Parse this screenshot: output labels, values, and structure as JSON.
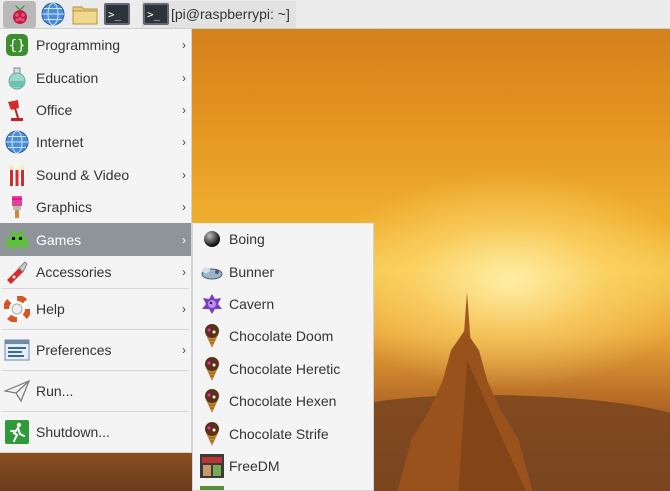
{
  "taskbar": {
    "launchers": [
      {
        "icon": "raspberry-pi-icon"
      },
      {
        "icon": "web-browser-globe-icon"
      },
      {
        "icon": "file-manager-folder-icon"
      },
      {
        "icon": "terminal-icon"
      }
    ],
    "task": {
      "icon": "terminal-icon",
      "label": "[pi@raspberrypi: ~]"
    }
  },
  "menu": {
    "items": [
      {
        "label": "Programming",
        "icon": "programming-icon",
        "submenu": true
      },
      {
        "label": "Education",
        "icon": "education-flask-icon",
        "submenu": true
      },
      {
        "label": "Office",
        "icon": "office-lamp-icon",
        "submenu": true
      },
      {
        "label": "Internet",
        "icon": "internet-globe-icon",
        "submenu": true
      },
      {
        "label": "Sound & Video",
        "icon": "sound-video-popcorn-icon",
        "submenu": true
      },
      {
        "label": "Graphics",
        "icon": "graphics-brush-icon",
        "submenu": true
      },
      {
        "label": "Games",
        "icon": "games-invader-icon",
        "submenu": true,
        "active": true
      },
      {
        "label": "Accessories",
        "icon": "accessories-knife-icon",
        "submenu": true
      },
      {
        "label": "Help",
        "icon": "help-lifebuoy-icon",
        "submenu": true
      },
      {
        "label": "Preferences",
        "icon": "preferences-icon",
        "submenu": true
      },
      {
        "label": "Run...",
        "icon": "run-paper-plane-icon",
        "submenu": false
      },
      {
        "label": "Shutdown...",
        "icon": "shutdown-exit-icon",
        "submenu": false
      }
    ],
    "arrow_glyph": "›"
  },
  "games_submenu": {
    "items": [
      {
        "label": "Boing",
        "icon": "boing-ball-icon"
      },
      {
        "label": "Bunner",
        "icon": "bunner-icon"
      },
      {
        "label": "Cavern",
        "icon": "cavern-icon"
      },
      {
        "label": "Chocolate Doom",
        "icon": "chocolate-doom-icon"
      },
      {
        "label": "Chocolate Heretic",
        "icon": "chocolate-heretic-icon"
      },
      {
        "label": "Chocolate Hexen",
        "icon": "chocolate-hexen-icon"
      },
      {
        "label": "Chocolate Strife",
        "icon": "chocolate-strife-icon"
      },
      {
        "label": "FreeDM",
        "icon": "freedm-icon"
      }
    ]
  },
  "colors": {
    "menu_bg": "#f4f4f4",
    "active_bg": "#8f949a",
    "taskbar_bg": "#ececec"
  }
}
